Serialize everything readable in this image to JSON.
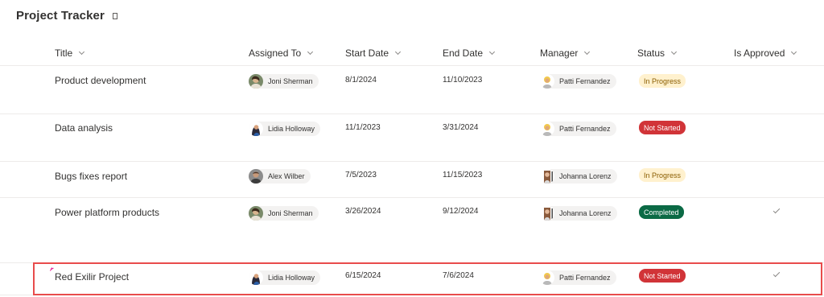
{
  "list": {
    "title": "Project Tracker"
  },
  "columns": [
    {
      "label": "Title"
    },
    {
      "label": "Assigned To"
    },
    {
      "label": "Start Date"
    },
    {
      "label": "End Date"
    },
    {
      "label": "Manager"
    },
    {
      "label": "Status"
    },
    {
      "label": "Is Approved"
    }
  ],
  "rows": [
    {
      "title": "Product development",
      "assigned": {
        "name": "Joni Sherman",
        "avatar": "joni-avatar"
      },
      "start": "8/1/2024",
      "end": "11/10/2023",
      "manager": {
        "name": "Patti Fernandez",
        "avatar": "patti-avatar"
      },
      "status": "In Progress",
      "approved": false
    },
    {
      "title": "Data analysis",
      "assigned": {
        "name": "Lidia Holloway",
        "avatar": "lidia-avatar"
      },
      "start": "11/1/2023",
      "end": "3/31/2024",
      "manager": {
        "name": "Patti Fernandez",
        "avatar": "patti-avatar"
      },
      "status": "Not Started",
      "approved": false
    },
    {
      "title": "Bugs fixes report",
      "assigned": {
        "name": "Alex Wilber",
        "avatar": "alex-avatar"
      },
      "start": "7/5/2023",
      "end": "11/15/2023",
      "manager": {
        "name": "Johanna Lorenz",
        "avatar": "johanna-avatar"
      },
      "status": "In Progress",
      "approved": false
    },
    {
      "title": "Power platform products",
      "assigned": {
        "name": "Joni Sherman",
        "avatar": "joni-avatar"
      },
      "start": "3/26/2024",
      "end": "9/12/2024",
      "manager": {
        "name": "Johanna Lorenz",
        "avatar": "johanna-avatar"
      },
      "status": "Completed",
      "approved": true
    },
    {
      "title": "Red Exilir Project",
      "assigned": {
        "name": "Lidia Holloway",
        "avatar": "lidia-avatar"
      },
      "start": "6/15/2024",
      "end": "7/6/2024",
      "manager": {
        "name": "Patti Fernandez",
        "avatar": "patti-avatar"
      },
      "status": "Not Started",
      "approved": true,
      "is_new": true,
      "highlighted": true
    }
  ],
  "colors": {
    "in_progress_bg": "#fff1ce",
    "in_progress_text": "#8a5d00",
    "not_started_bg": "#d13438",
    "completed_bg": "#0b6a45",
    "highlight_border": "#e84c4c",
    "new_marker": "#e3008c"
  }
}
